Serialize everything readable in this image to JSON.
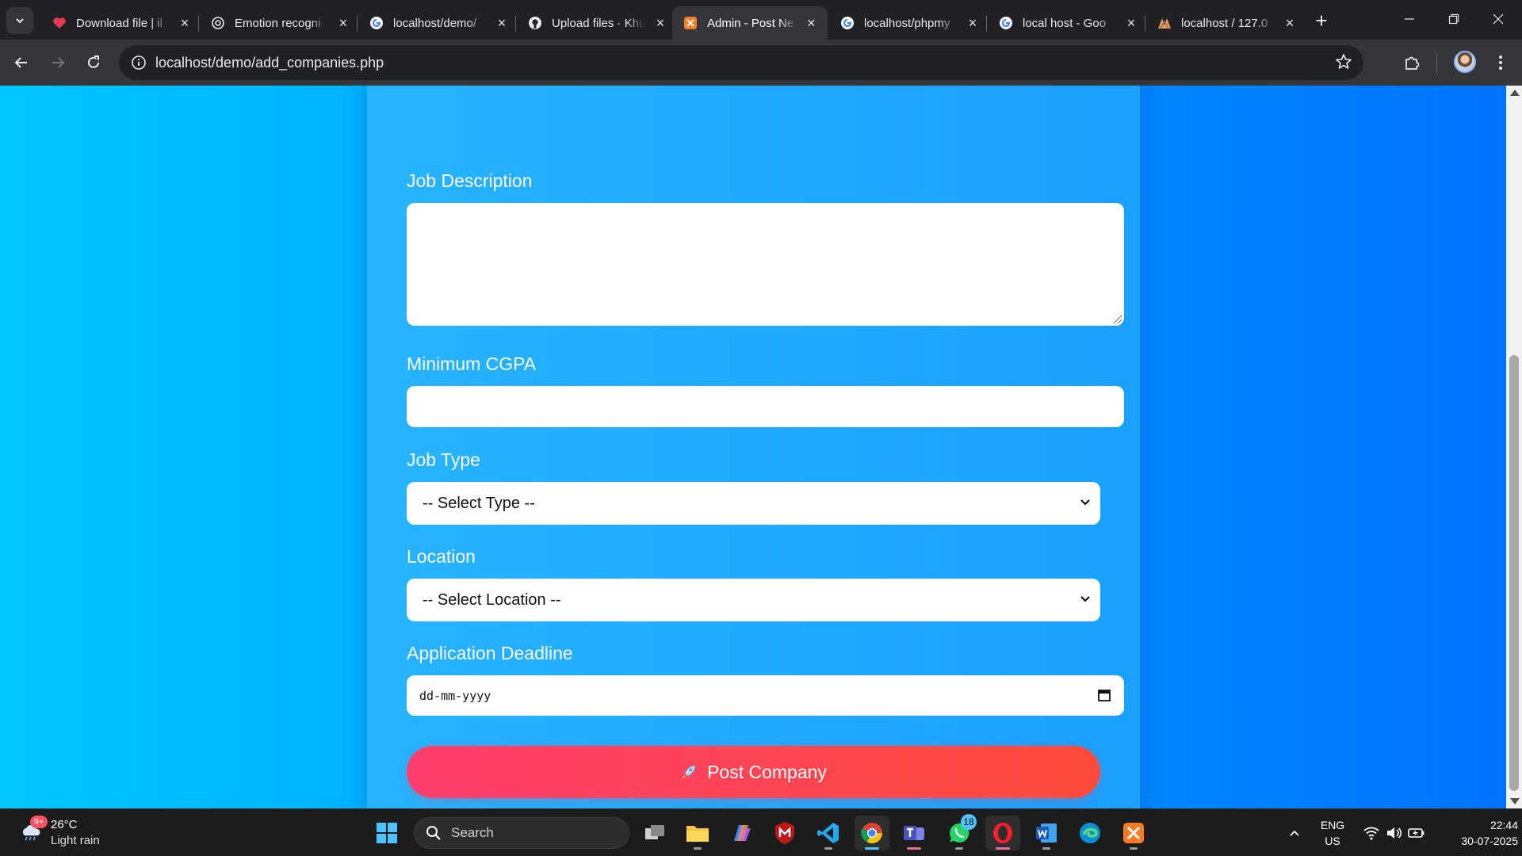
{
  "browser": {
    "tabs": [
      {
        "title": "Download file | il",
        "favicon": "heart-icon",
        "active": false
      },
      {
        "title": "Emotion recogni",
        "favicon": "openai-icon",
        "active": false
      },
      {
        "title": "localhost/demo/",
        "favicon": "google-icon",
        "active": false
      },
      {
        "title": "Upload files · Khu",
        "favicon": "github-icon",
        "active": false
      },
      {
        "title": "Admin - Post Ne",
        "favicon": "xampp-icon",
        "active": true
      },
      {
        "title": "localhost/phpmy",
        "favicon": "google-icon",
        "active": false
      },
      {
        "title": "local host - Goo",
        "favicon": "google-icon",
        "active": false
      },
      {
        "title": "localhost / 127.0",
        "favicon": "phpmyadmin-icon",
        "active": false
      }
    ],
    "address_bar": {
      "url": "localhost/demo/add_companies.php"
    }
  },
  "form": {
    "job_description": {
      "label": "Job Description",
      "value": ""
    },
    "min_cgpa": {
      "label": "Minimum CGPA",
      "value": ""
    },
    "job_type": {
      "label": "Job Type",
      "selected": "-- Select Type --"
    },
    "location": {
      "label": "Location",
      "selected": "-- Select Location --"
    },
    "deadline": {
      "label": "Application Deadline",
      "placeholder": "dd-mm-yyyy"
    },
    "submit": {
      "icon": "rocket-icon",
      "label": "Post Company"
    }
  },
  "taskbar": {
    "weather": {
      "temp": "26°C",
      "condition": "Light rain",
      "badge": "9+"
    },
    "search_label": "Search",
    "whatsapp_badge": "18",
    "language": {
      "lang": "ENG",
      "region": "US"
    },
    "clock": {
      "time": "22:44",
      "date": "30-07-2025"
    }
  },
  "colors": {
    "page_gradient": [
      "#00c6ff",
      "#0072ff"
    ],
    "submit_gradient": [
      "#ff3d6e",
      "#ff4b3a"
    ],
    "card": "#1fa8ff"
  }
}
